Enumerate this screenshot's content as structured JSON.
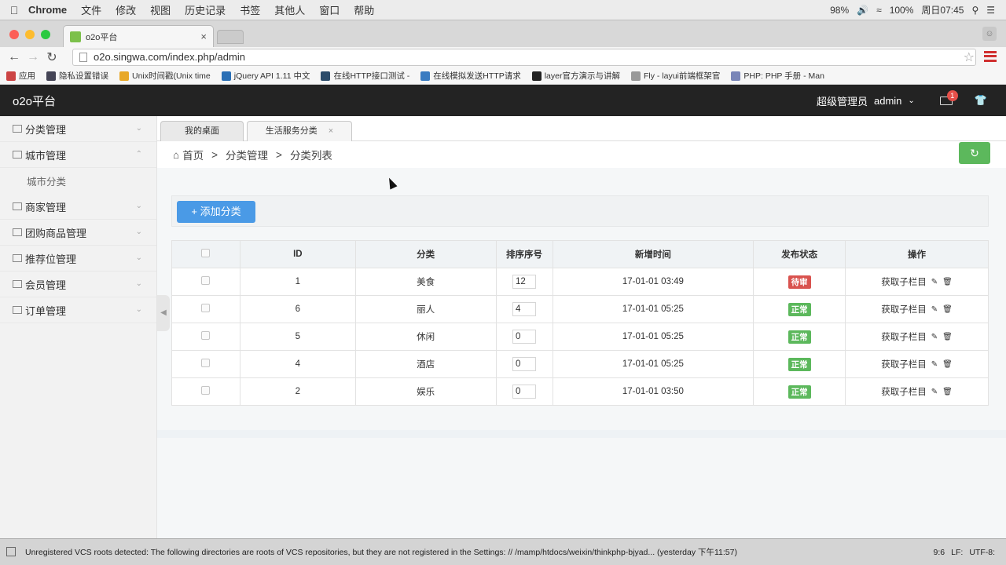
{
  "os_menu": {
    "app": "Chrome",
    "items": [
      "文件",
      "修改",
      "视图",
      "历史记录",
      "书签",
      "其他人",
      "窗口",
      "帮助"
    ],
    "battery1": "98%",
    "battery2": "100%",
    "clock": "周日07:45"
  },
  "browser": {
    "tab_title": "o2o平台",
    "url": "o2o.singwa.com/index.php/admin",
    "bookmarks": [
      "应用",
      "隐私设置错误",
      "Unix时间戳(Unix time",
      "jQuery API 1.11 中文",
      "在线HTTP接口测试 -",
      "在线模拟发送HTTP请求",
      "layer官方演示与讲解",
      "Fly - layui前端框架官",
      "PHP: PHP 手册 - Man"
    ]
  },
  "header": {
    "logo": "o2o平台",
    "role": "超级管理员",
    "user": "admin",
    "mail_badge": "1"
  },
  "sidebar": {
    "items": [
      {
        "label": "分类管理",
        "expanded": false
      },
      {
        "label": "城市管理",
        "expanded": true
      },
      {
        "label": "商家管理",
        "expanded": false
      },
      {
        "label": "团购商品管理",
        "expanded": false
      },
      {
        "label": "推荐位管理",
        "expanded": false
      },
      {
        "label": "会员管理",
        "expanded": false
      },
      {
        "label": "订单管理",
        "expanded": false
      }
    ],
    "sub_city": "城市分类"
  },
  "tabs": {
    "desk": "我的桌面",
    "active": "生活服务分类"
  },
  "breadcrumb": {
    "home": "首页",
    "sep": ">",
    "c1": "分类管理",
    "c2": "分类列表"
  },
  "add_button": "添加分类",
  "table": {
    "headers": [
      "ID",
      "分类",
      "排序序号",
      "新增时间",
      "发布状态",
      "操作"
    ],
    "op_label": "获取子栏目",
    "rows": [
      {
        "id": "1",
        "name": "美食",
        "sort": "12",
        "time": "17-01-01 03:49",
        "status": "待审",
        "status_color": "#d9534f"
      },
      {
        "id": "6",
        "name": "丽人",
        "sort": "4",
        "time": "17-01-01 05:25",
        "status": "正常",
        "status_color": "#5cb85c"
      },
      {
        "id": "5",
        "name": "休闲",
        "sort": "0",
        "time": "17-01-01 05:25",
        "status": "正常",
        "status_color": "#5cb85c"
      },
      {
        "id": "4",
        "name": "酒店",
        "sort": "0",
        "time": "17-01-01 05:25",
        "status": "正常",
        "status_color": "#5cb85c"
      },
      {
        "id": "2",
        "name": "娱乐",
        "sort": "0",
        "time": "17-01-01 03:50",
        "status": "正常",
        "status_color": "#5cb85c"
      }
    ]
  },
  "statusbar": {
    "message": "Unregistered VCS roots detected: The following directories are roots of VCS repositories, but they are not registered in the Settings: // /mamp/htdocs/weixin/thinkphp-bjyad... (yesterday 下午11:57)",
    "pos": "9:6",
    "lf": "LF:",
    "enc": "UTF-8:"
  }
}
